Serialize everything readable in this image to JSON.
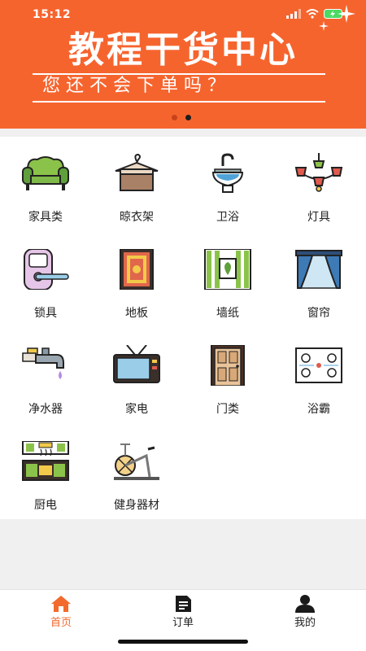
{
  "status_bar": {
    "time": "15:12"
  },
  "banner": {
    "title": "教程干货中心",
    "subtitle": "您还不会下单吗？",
    "carousel": {
      "total": 2,
      "active": 2
    }
  },
  "categories": [
    {
      "label": "家具类",
      "icon": "sofa-icon"
    },
    {
      "label": "晾衣架",
      "icon": "clothes-hanger-icon"
    },
    {
      "label": "卫浴",
      "icon": "sink-icon"
    },
    {
      "label": "灯具",
      "icon": "chandelier-icon"
    },
    {
      "label": "锁具",
      "icon": "door-lock-icon"
    },
    {
      "label": "地板",
      "icon": "floor-rug-icon"
    },
    {
      "label": "墙纸",
      "icon": "wallpaper-icon"
    },
    {
      "label": "窗帘",
      "icon": "curtain-icon"
    },
    {
      "label": "净水器",
      "icon": "water-faucet-icon"
    },
    {
      "label": "家电",
      "icon": "tv-icon"
    },
    {
      "label": "门类",
      "icon": "door-icon"
    },
    {
      "label": "浴霸",
      "icon": "bath-heater-icon"
    },
    {
      "label": "厨电",
      "icon": "kitchen-appliance-icon"
    },
    {
      "label": "健身器材",
      "icon": "exercise-bike-icon"
    }
  ],
  "tabbar": {
    "home": "首页",
    "orders": "订单",
    "profile": "我的",
    "active_color": "#f26a2d"
  },
  "colors": {
    "banner": "#f6642e",
    "accent": "#f26a2d"
  }
}
